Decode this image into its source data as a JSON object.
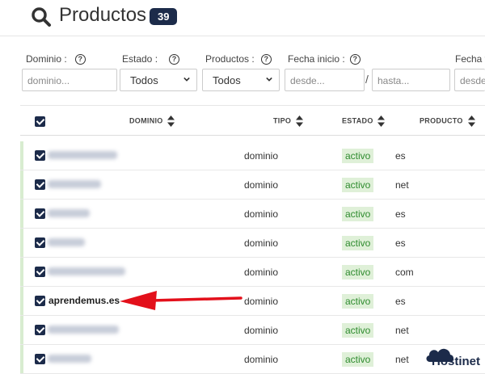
{
  "header": {
    "title": "Productos",
    "count": "39"
  },
  "filters": {
    "domain": {
      "label": "Dominio :",
      "placeholder": "dominio..."
    },
    "state": {
      "label": "Estado :",
      "value": "Todos"
    },
    "products": {
      "label": "Productos :",
      "value": "Todos"
    },
    "start_date": {
      "label": "Fecha inicio :",
      "from_placeholder": "desde...",
      "separator": "/",
      "to_placeholder": "hasta..."
    },
    "end_date": {
      "label": "Fecha fi",
      "placeholder": "desde"
    },
    "help_glyph": "?"
  },
  "table": {
    "columns": [
      "DOMINIO",
      "TIPO",
      "ESTADO",
      "PRODUCTO"
    ],
    "rows": [
      {
        "domain": "",
        "type": "dominio",
        "state": "activo",
        "product": "es"
      },
      {
        "domain": "",
        "type": "dominio",
        "state": "activo",
        "product": "net"
      },
      {
        "domain": "",
        "type": "dominio",
        "state": "activo",
        "product": "es"
      },
      {
        "domain": "",
        "type": "dominio",
        "state": "activo",
        "product": "es"
      },
      {
        "domain": "",
        "type": "dominio",
        "state": "activo",
        "product": "com"
      },
      {
        "domain": "aprendemus.es",
        "type": "dominio",
        "state": "activo",
        "product": "es"
      },
      {
        "domain": "",
        "type": "dominio",
        "state": "activo",
        "product": "net"
      },
      {
        "domain": "",
        "type": "dominio",
        "state": "activo",
        "product": "net"
      }
    ]
  },
  "watermark": {
    "text": "Hostinet"
  },
  "colors": {
    "accent": "#1c2b4a",
    "active_bg": "#dff0d8",
    "active_text": "#2e8b2e",
    "arrow": "#e3101b"
  }
}
